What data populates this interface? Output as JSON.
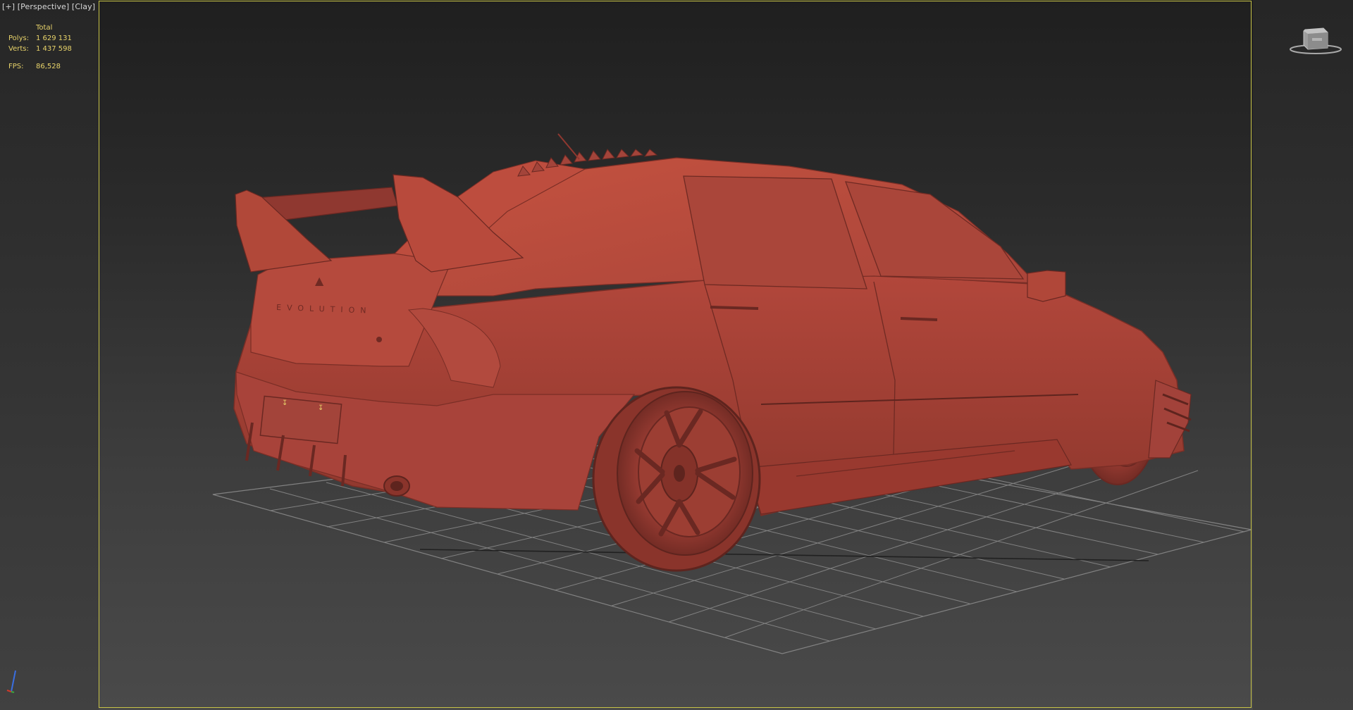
{
  "viewport": {
    "label": {
      "plus": "[+]",
      "view": "[Perspective]",
      "shading": "[Clay]"
    },
    "stats": {
      "header": "Total",
      "polys_label": "Polys:",
      "polys_value": "1 629 131",
      "verts_label": "Verts:",
      "verts_value": "1 437 598",
      "fps_label": "FPS:",
      "fps_value": "86,528"
    }
  },
  "scene": {
    "object": "car-model",
    "shading_color": "#b4483c",
    "grid_color": "#8a8a8a",
    "active_border_color": "#c8c447"
  },
  "icons": {
    "viewcube": "viewcube-icon",
    "axis": "axis-tripod-icon"
  }
}
